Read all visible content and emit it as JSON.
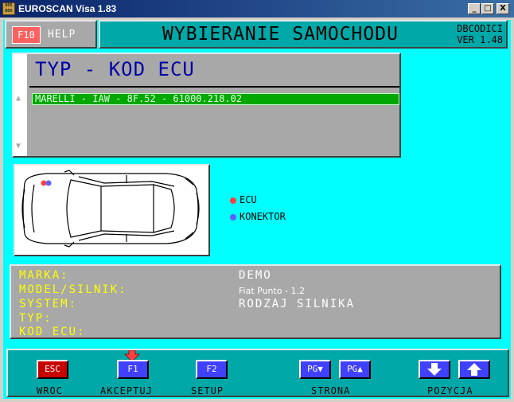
{
  "window": {
    "title": "EUROSCAN Visa 1.83",
    "icon_text": "DOS BOX",
    "minimize": "_",
    "maximize": "□",
    "close": "X"
  },
  "header": {
    "f10_label": "F10",
    "help_label": "HELP",
    "title": "WYBIERANIE SAMOCHODU",
    "db_line1": "DBCODICI",
    "db_line2": "VER 1.48"
  },
  "list": {
    "title": "TYP - KOD ECU",
    "items": [
      "MARELLI - IAW - 8F.52 - 61000.218.02"
    ],
    "scroll_up_icon": "arrow-up-icon",
    "scroll_down_icon": "arrow-down-icon"
  },
  "legend": {
    "ecu": "ECU",
    "connector": "KONEKTOR",
    "ecu_color": "#ff4040",
    "connector_color": "#6060ff"
  },
  "info": {
    "marka_label": "MARKA:",
    "marka_value": "DEMO",
    "model_label": "MODEL/SILNIK:",
    "model_value": "Fiat Punto - 1.2",
    "system_label": "SYSTEM:",
    "system_value": "RODZAJ SILNIKA",
    "typ_label": "TYP:",
    "typ_value": "",
    "kod_label": "KOD ECU:",
    "kod_value": ""
  },
  "bottom": {
    "esc_label": "ESC",
    "esc_caption": "WROC",
    "f1_label": "F1",
    "f1_caption": "AKCEPTUJ",
    "f2_label": "F2",
    "f2_caption": "SETUP",
    "pgdn_label": "PG▼",
    "pgup_label": "PG▲",
    "strona_caption": "STRONA",
    "pos_down_icon": "arrow-down-icon",
    "pos_up_icon": "arrow-up-icon",
    "pozycja_caption": "POZYCJA"
  },
  "colors": {
    "background": "#00ffff",
    "panel": "#a8a8a8",
    "accent": "#00a8a8",
    "selected_row": "#00a800",
    "label_yellow": "#ffff00"
  }
}
